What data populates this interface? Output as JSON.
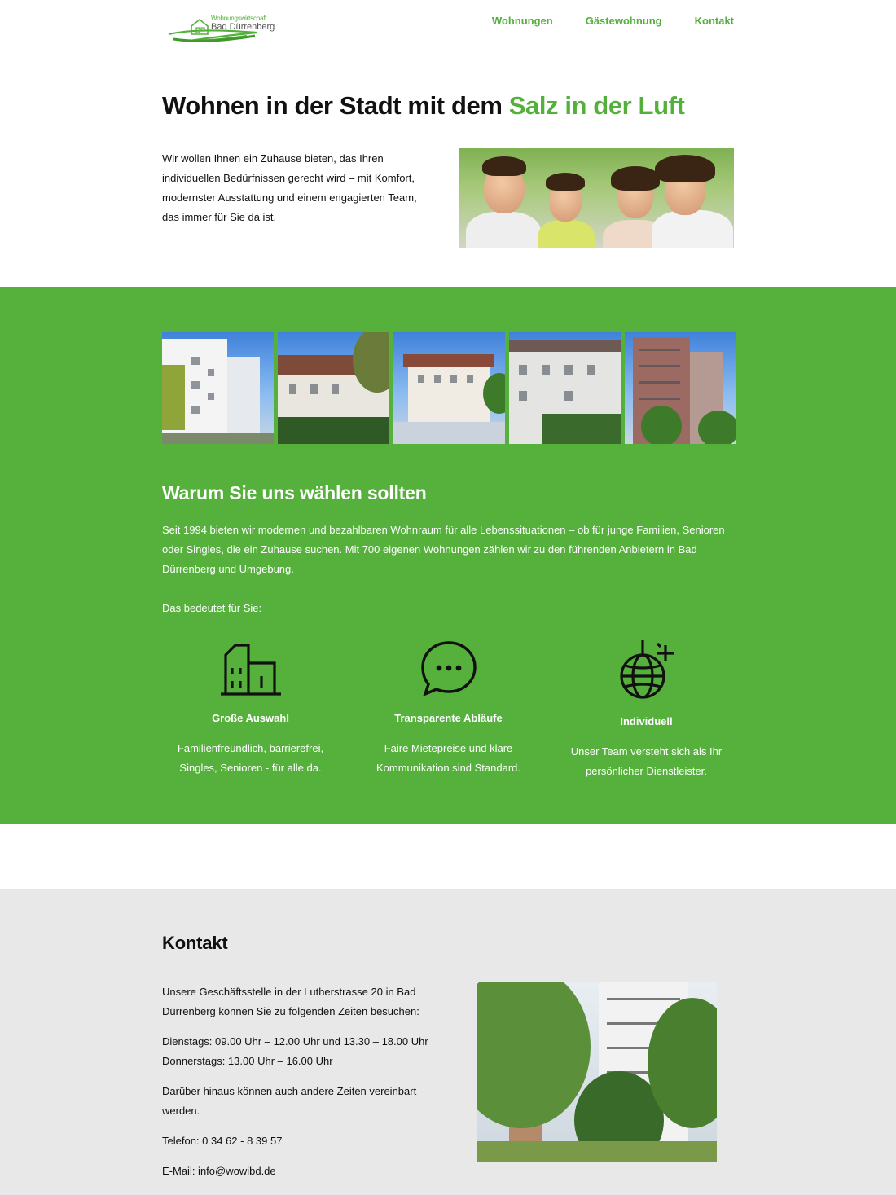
{
  "header": {
    "logo": {
      "line1": "Wohnungswirtschaft",
      "line2": "Bad Dürrenberg"
    },
    "nav": [
      "Wohnungen",
      "Gästewohnung",
      "Kontakt"
    ]
  },
  "hero": {
    "title_main": "Wohnen in der Stadt mit dem ",
    "title_highlight": "Salz in der Luft",
    "text": "Wir wollen Ihnen ein Zuhause bieten, das Ihren individuellen Bedürfnissen gerecht wird – mit Komfort, modernster Ausstattung und einem engagierten Team, das immer für Sie da ist."
  },
  "why": {
    "title": "Warum Sie uns wählen sollten",
    "text": "Seit 1994 bieten wir modernen und bezahlbaren Wohnraum für alle Lebenssituationen – ob für junge Familien, Senioren oder Singles, die ein Zuhause suchen. Mit 700 eigenen Wohnungen zählen wir zu den führenden Anbietern in Bad Dürrenberg und Umgebung.",
    "sub": "Das bedeutet für Sie:",
    "features": [
      {
        "icon": "building-icon",
        "title": "Große Auswahl",
        "desc": "Familienfreundlich, barrierefrei, Singles, Senioren - für alle da."
      },
      {
        "icon": "chat-bubble-icon",
        "title": "Transparente Abläufe",
        "desc": "Faire Mietepreise und klare Kommunikation sind Standard."
      },
      {
        "icon": "disco-ball-icon",
        "title": "Individuell",
        "desc": "Unser Team versteht sich als Ihr persönlicher Dienstleister."
      }
    ]
  },
  "contact": {
    "title": "Kontakt",
    "address": "Unsere Geschäftsstelle in der Lutherstrasse 20 in Bad Dürrenberg können Sie zu folgenden Zeiten besuchen:",
    "hours1": "Dienstags: 09.00 Uhr – 12.00 Uhr und 13.30 – 18.00 Uhr",
    "hours2": "Donnerstags: 13.00 Uhr – 16.00 Uhr",
    "other": "Darüber hinaus können auch andere Zeiten vereinbart werden.",
    "phone": "Telefon: 0 34 62 - 8 39 57",
    "email": "E-Mail: info@wowibd.de"
  },
  "colors": {
    "accent": "#55b13c",
    "nav": "#52b03b",
    "contact_bg": "#e8e8e8"
  }
}
